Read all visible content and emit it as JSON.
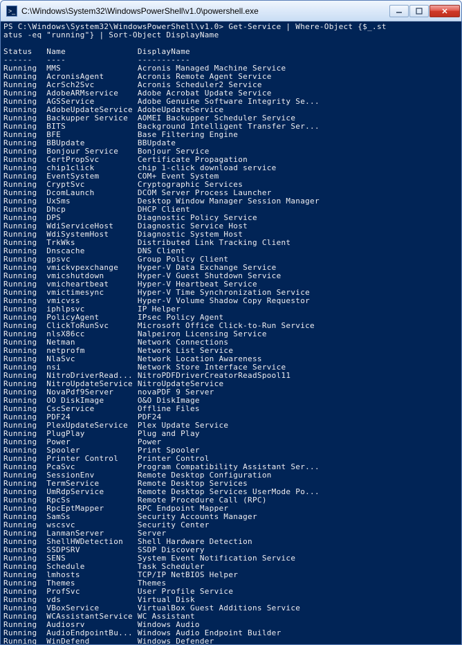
{
  "window": {
    "title": "C:\\Windows\\System32\\WindowsPowerShell\\v1.0\\powershell.exe"
  },
  "prompt": "PS C:\\Windows\\System32\\WindowsPowerShell\\v1.0> Get-Service | Where-Object {$_.st\natus -eq \"running\"} | Sort-Object DisplayName",
  "columns": {
    "status": "Status",
    "name": "Name",
    "displayName": "DisplayName"
  },
  "underlines": {
    "status": "------",
    "name": "----",
    "displayName": "-----------"
  },
  "services": [
    {
      "status": "Running",
      "name": "MMS",
      "displayName": "Acronis Managed Machine Service"
    },
    {
      "status": "Running",
      "name": "AcronisAgent",
      "displayName": "Acronis Remote Agent Service"
    },
    {
      "status": "Running",
      "name": "AcrSch2Svc",
      "displayName": "Acronis Scheduler2 Service"
    },
    {
      "status": "Running",
      "name": "AdobeARMservice",
      "displayName": "Adobe Acrobat Update Service"
    },
    {
      "status": "Running",
      "name": "AGSService",
      "displayName": "Adobe Genuine Software Integrity Se..."
    },
    {
      "status": "Running",
      "name": "AdobeUpdateService",
      "displayName": "AdobeUpdateService"
    },
    {
      "status": "Running",
      "name": "Backupper Service",
      "displayName": "AOMEI Backupper Scheduler Service"
    },
    {
      "status": "Running",
      "name": "BITS",
      "displayName": "Background Intelligent Transfer Ser..."
    },
    {
      "status": "Running",
      "name": "BFE",
      "displayName": "Base Filtering Engine"
    },
    {
      "status": "Running",
      "name": "BBUpdate",
      "displayName": "BBUpdate"
    },
    {
      "status": "Running",
      "name": "Bonjour Service",
      "displayName": "Bonjour Service"
    },
    {
      "status": "Running",
      "name": "CertPropSvc",
      "displayName": "Certificate Propagation"
    },
    {
      "status": "Running",
      "name": "chip1click",
      "displayName": "chip 1-click download service"
    },
    {
      "status": "Running",
      "name": "EventSystem",
      "displayName": "COM+ Event System"
    },
    {
      "status": "Running",
      "name": "CryptSvc",
      "displayName": "Cryptographic Services"
    },
    {
      "status": "Running",
      "name": "DcomLaunch",
      "displayName": "DCOM Server Process Launcher"
    },
    {
      "status": "Running",
      "name": "UxSms",
      "displayName": "Desktop Window Manager Session Manager"
    },
    {
      "status": "Running",
      "name": "Dhcp",
      "displayName": "DHCP Client"
    },
    {
      "status": "Running",
      "name": "DPS",
      "displayName": "Diagnostic Policy Service"
    },
    {
      "status": "Running",
      "name": "WdiServiceHost",
      "displayName": "Diagnostic Service Host"
    },
    {
      "status": "Running",
      "name": "WdiSystemHost",
      "displayName": "Diagnostic System Host"
    },
    {
      "status": "Running",
      "name": "TrkWks",
      "displayName": "Distributed Link Tracking Client"
    },
    {
      "status": "Running",
      "name": "Dnscache",
      "displayName": "DNS Client"
    },
    {
      "status": "Running",
      "name": "gpsvc",
      "displayName": "Group Policy Client"
    },
    {
      "status": "Running",
      "name": "vmickvpexchange",
      "displayName": "Hyper-V Data Exchange Service"
    },
    {
      "status": "Running",
      "name": "vmicshutdown",
      "displayName": "Hyper-V Guest Shutdown Service"
    },
    {
      "status": "Running",
      "name": "vmicheartbeat",
      "displayName": "Hyper-V Heartbeat Service"
    },
    {
      "status": "Running",
      "name": "vmictimesync",
      "displayName": "Hyper-V Time Synchronization Service"
    },
    {
      "status": "Running",
      "name": "vmicvss",
      "displayName": "Hyper-V Volume Shadow Copy Requestor"
    },
    {
      "status": "Running",
      "name": "iphlpsvc",
      "displayName": "IP Helper"
    },
    {
      "status": "Running",
      "name": "PolicyAgent",
      "displayName": "IPsec Policy Agent"
    },
    {
      "status": "Running",
      "name": "ClickToRunSvc",
      "displayName": "Microsoft Office Click-to-Run Service"
    },
    {
      "status": "Running",
      "name": "nlsX86cc",
      "displayName": "Nalpeiron Licensing Service"
    },
    {
      "status": "Running",
      "name": "Netman",
      "displayName": "Network Connections"
    },
    {
      "status": "Running",
      "name": "netprofm",
      "displayName": "Network List Service"
    },
    {
      "status": "Running",
      "name": "NlaSvc",
      "displayName": "Network Location Awareness"
    },
    {
      "status": "Running",
      "name": "nsi",
      "displayName": "Network Store Interface Service"
    },
    {
      "status": "Running",
      "name": "NitroDriverRead...",
      "displayName": "NitroPDFDriverCreatorReadSpool11"
    },
    {
      "status": "Running",
      "name": "NitroUpdateService",
      "displayName": "NitroUpdateService"
    },
    {
      "status": "Running",
      "name": "NovaPdf9Server",
      "displayName": "novaPDF 9 Server"
    },
    {
      "status": "Running",
      "name": "OO DiskImage",
      "displayName": "O&O DiskImage"
    },
    {
      "status": "Running",
      "name": "CscService",
      "displayName": "Offline Files"
    },
    {
      "status": "Running",
      "name": "PDF24",
      "displayName": "PDF24"
    },
    {
      "status": "Running",
      "name": "PlexUpdateService",
      "displayName": "Plex Update Service"
    },
    {
      "status": "Running",
      "name": "PlugPlay",
      "displayName": "Plug and Play"
    },
    {
      "status": "Running",
      "name": "Power",
      "displayName": "Power"
    },
    {
      "status": "Running",
      "name": "Spooler",
      "displayName": "Print Spooler"
    },
    {
      "status": "Running",
      "name": "Printer Control",
      "displayName": "Printer Control"
    },
    {
      "status": "Running",
      "name": "PcaSvc",
      "displayName": "Program Compatibility Assistant Ser..."
    },
    {
      "status": "Running",
      "name": "SessionEnv",
      "displayName": "Remote Desktop Configuration"
    },
    {
      "status": "Running",
      "name": "TermService",
      "displayName": "Remote Desktop Services"
    },
    {
      "status": "Running",
      "name": "UmRdpService",
      "displayName": "Remote Desktop Services UserMode Po..."
    },
    {
      "status": "Running",
      "name": "RpcSs",
      "displayName": "Remote Procedure Call (RPC)"
    },
    {
      "status": "Running",
      "name": "RpcEptMapper",
      "displayName": "RPC Endpoint Mapper"
    },
    {
      "status": "Running",
      "name": "SamSs",
      "displayName": "Security Accounts Manager"
    },
    {
      "status": "Running",
      "name": "wscsvc",
      "displayName": "Security Center"
    },
    {
      "status": "Running",
      "name": "LanmanServer",
      "displayName": "Server"
    },
    {
      "status": "Running",
      "name": "ShellHWDetection",
      "displayName": "Shell Hardware Detection"
    },
    {
      "status": "Running",
      "name": "SSDPSRV",
      "displayName": "SSDP Discovery"
    },
    {
      "status": "Running",
      "name": "SENS",
      "displayName": "System Event Notification Service"
    },
    {
      "status": "Running",
      "name": "Schedule",
      "displayName": "Task Scheduler"
    },
    {
      "status": "Running",
      "name": "lmhosts",
      "displayName": "TCP/IP NetBIOS Helper"
    },
    {
      "status": "Running",
      "name": "Themes",
      "displayName": "Themes"
    },
    {
      "status": "Running",
      "name": "ProfSvc",
      "displayName": "User Profile Service"
    },
    {
      "status": "Running",
      "name": "vds",
      "displayName": "Virtual Disk"
    },
    {
      "status": "Running",
      "name": "VBoxService",
      "displayName": "VirtualBox Guest Additions Service"
    },
    {
      "status": "Running",
      "name": "WCAssistantService",
      "displayName": "WC Assistant"
    },
    {
      "status": "Running",
      "name": "Audiosrv",
      "displayName": "Windows Audio"
    },
    {
      "status": "Running",
      "name": "AudioEndpointBu...",
      "displayName": "Windows Audio Endpoint Builder"
    },
    {
      "status": "Running",
      "name": "WinDefend",
      "displayName": "Windows Defender"
    }
  ]
}
